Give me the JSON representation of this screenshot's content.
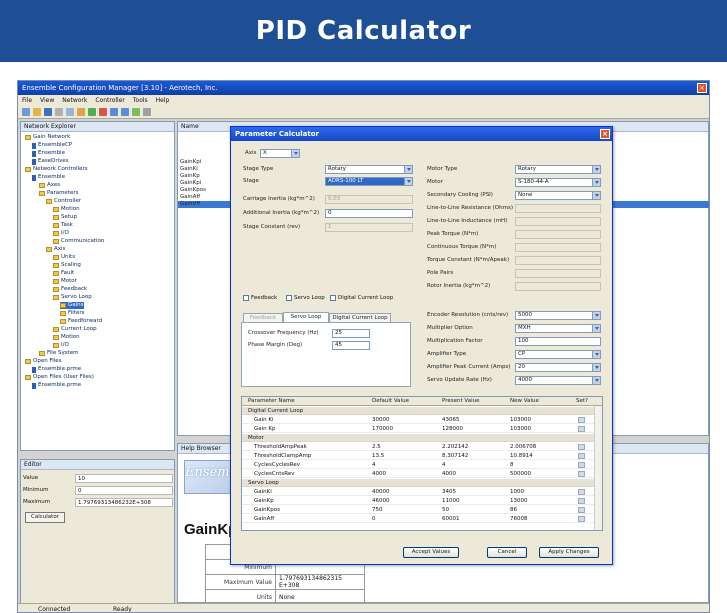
{
  "banner": {
    "title": "PID Calculator"
  },
  "app": {
    "title": "Ensemble Configuration Manager [3.10] - Aerotech, Inc.",
    "menu": [
      "File",
      "View",
      "Network",
      "Controller",
      "Tools",
      "Help"
    ],
    "network_explorer_label": "Network Explorer",
    "name_column": "Name",
    "help_pane_label": "Help Browser",
    "status": {
      "left": "Connected",
      "right": "Ready"
    }
  },
  "tree": [
    {
      "label": "Gain Network",
      "indent": 0,
      "kind": "folder"
    },
    {
      "label": "EnsembleCP",
      "indent": 1,
      "kind": "node"
    },
    {
      "label": "Ensemble",
      "indent": 1,
      "kind": "node"
    },
    {
      "label": "EaseDrives",
      "indent": 1,
      "kind": "node"
    },
    {
      "label": "Network Controllers",
      "indent": 0,
      "kind": "folder"
    },
    {
      "label": "Ensemble",
      "indent": 1,
      "kind": "node"
    },
    {
      "label": "Axes",
      "indent": 2,
      "kind": "folder"
    },
    {
      "label": "Parameters",
      "indent": 2,
      "kind": "folder"
    },
    {
      "label": "Controller",
      "indent": 3,
      "kind": "folder"
    },
    {
      "label": "Motion",
      "indent": 4,
      "kind": "folder"
    },
    {
      "label": "Setup",
      "indent": 4,
      "kind": "folder"
    },
    {
      "label": "Task",
      "indent": 4,
      "kind": "folder"
    },
    {
      "label": "I/O",
      "indent": 4,
      "kind": "folder"
    },
    {
      "label": "Communication",
      "indent": 4,
      "kind": "folder"
    },
    {
      "label": "Axis",
      "indent": 3,
      "kind": "folder"
    },
    {
      "label": "Units",
      "indent": 4,
      "kind": "folder"
    },
    {
      "label": "Scaling",
      "indent": 4,
      "kind": "folder"
    },
    {
      "label": "Fault",
      "indent": 4,
      "kind": "folder"
    },
    {
      "label": "Motor",
      "indent": 4,
      "kind": "folder"
    },
    {
      "label": "Feedback",
      "indent": 4,
      "kind": "folder"
    },
    {
      "label": "Servo Loop",
      "indent": 4,
      "kind": "folder"
    },
    {
      "label": "Gains",
      "indent": 5,
      "kind": "folder",
      "selected": true
    },
    {
      "label": "Filters",
      "indent": 5,
      "kind": "folder"
    },
    {
      "label": "Feedforward",
      "indent": 5,
      "kind": "folder"
    },
    {
      "label": "Current Loop",
      "indent": 4,
      "kind": "folder"
    },
    {
      "label": "Motion",
      "indent": 4,
      "kind": "folder"
    },
    {
      "label": "I/O",
      "indent": 4,
      "kind": "folder"
    },
    {
      "label": "File System",
      "indent": 2,
      "kind": "folder"
    },
    {
      "label": "Open Files",
      "indent": 0,
      "kind": "folder"
    },
    {
      "label": "Ensemble.prme",
      "indent": 1,
      "kind": "node"
    },
    {
      "label": "Open Files (User Files)",
      "indent": 0,
      "kind": "folder"
    },
    {
      "label": "Ensemble.prme",
      "indent": 1,
      "kind": "node"
    }
  ],
  "list_items": [
    "GainKpi",
    "GainKi",
    "GainKp",
    "GainKpi",
    "GainKpos",
    "GainAff",
    "GainVff"
  ],
  "edit_pane": {
    "title": "Editor",
    "rows": [
      {
        "key": "Value",
        "value": "10"
      },
      {
        "key": "Minimum",
        "value": "0"
      },
      {
        "key": "Maximum",
        "value": "1.79769313486232E+308"
      }
    ],
    "calculator_button": "Calculator"
  },
  "help": {
    "logo_text": "Ensemble",
    "heading": "GainKp",
    "rows": [
      {
        "key": "Default",
        "value": ""
      },
      {
        "key": "Minimum",
        "value": ""
      },
      {
        "key": "Maximum Value",
        "value": "1.797693134862315 E+308"
      },
      {
        "key": "Units",
        "value": "None"
      }
    ]
  },
  "dialog": {
    "title": "Parameter Calculator",
    "axis": {
      "label": "Axis",
      "value": "X"
    },
    "left_fields": [
      {
        "label": "Stage Type",
        "value": "Rotary",
        "kind": "select"
      },
      {
        "label": "Stage",
        "value": "ADRS-100 LT",
        "kind": "select",
        "highlight": true
      },
      {
        "label": "Carriage Inertia (kg*m^2)",
        "value": "0.03",
        "kind": "input",
        "disabled": true
      },
      {
        "label": "Additional Inertia (kg*m^2)",
        "value": "0",
        "kind": "input"
      },
      {
        "label": "Stage Constant (rev)",
        "value": "1",
        "kind": "input",
        "disabled": true
      }
    ],
    "right_fields": [
      {
        "label": "Motor Type",
        "value": "Rotary",
        "kind": "select"
      },
      {
        "label": "Motor",
        "value": "S-180-44-A",
        "kind": "select"
      },
      {
        "label": "Secondary Cooling (PSI)",
        "value": "None",
        "kind": "select"
      },
      {
        "label": "Line-to-Line Resistance (Ohms)",
        "value": "",
        "kind": "input",
        "disabled": true
      },
      {
        "label": "Line-to-Line Inductance (mH)",
        "value": "",
        "kind": "input",
        "disabled": true
      },
      {
        "label": "Peak Torque (N*m)",
        "value": "",
        "kind": "input",
        "disabled": true
      },
      {
        "label": "Continuous Torque (N*m)",
        "value": "",
        "kind": "input",
        "disabled": true
      },
      {
        "label": "Torque Constant (N*m/Apeak)",
        "value": "",
        "kind": "input",
        "disabled": true
      },
      {
        "label": "Pole Pairs",
        "value": "",
        "kind": "input",
        "disabled": true
      },
      {
        "label": "Rotor Inertia (kg*m^2)",
        "value": "",
        "kind": "input",
        "disabled": true
      }
    ],
    "checkboxes": [
      "Feedback",
      "Servo Loop",
      "Digital Current Loop"
    ],
    "tabs": [
      "Feedback",
      "Servo Loop",
      "Digital Current Loop"
    ],
    "servo_fields": [
      {
        "label": "Crossover Frequency (Hz)",
        "value": "25"
      },
      {
        "label": "Phase Margin (Deg)",
        "value": "45"
      }
    ],
    "feedback_fields": [
      {
        "label": "Encoder Resolution (cnts/rev)",
        "value": "5000",
        "kind": "select"
      },
      {
        "label": "Multiplier Option",
        "value": "MXH",
        "kind": "select"
      },
      {
        "label": "Multiplication Factor",
        "value": "100",
        "kind": "input"
      },
      {
        "label": "Amplifier Type",
        "value": "CP",
        "kind": "select"
      },
      {
        "label": "Amplifier Peak Current (Amps)",
        "value": "20",
        "kind": "select"
      },
      {
        "label": "Servo Update Rate (Hz)",
        "value": "4000",
        "kind": "select"
      }
    ],
    "grid_columns": [
      "Parameter Name",
      "Default Value",
      "Present Value",
      "New Value",
      "Set?"
    ],
    "grid_groups": [
      {
        "name": "Digital Current Loop",
        "rows": [
          {
            "name": "Gain Ki",
            "default": "30000",
            "present": "43065",
            "new": "103000"
          },
          {
            "name": "Gain Kp",
            "default": "170000",
            "present": "128000",
            "new": "103000"
          }
        ]
      },
      {
        "name": "Motor",
        "rows": [
          {
            "name": "ThresholdAmpPeak",
            "default": "2.5",
            "present": "2.202142",
            "new": "2.006708"
          },
          {
            "name": "ThresholdClampAmp",
            "default": "13.5",
            "present": "8.307142",
            "new": "10.8914"
          },
          {
            "name": "CyclesCyclesRev",
            "default": "4",
            "present": "4",
            "new": "8"
          },
          {
            "name": "CyclesCntsRev",
            "default": "4000",
            "present": "4000",
            "new": "500000"
          }
        ]
      },
      {
        "name": "Servo Loop",
        "rows": [
          {
            "name": "GainKi",
            "default": "40000",
            "present": "3405",
            "new": "1000"
          },
          {
            "name": "GainKp",
            "default": "46000",
            "present": "11000",
            "new": "13000"
          },
          {
            "name": "GainKpos",
            "default": "750",
            "present": "50",
            "new": "86"
          },
          {
            "name": "GainAff",
            "default": "0",
            "present": "60001",
            "new": "76008"
          }
        ]
      }
    ],
    "buttons": {
      "accept": "Accept Values",
      "cancel": "Cancel",
      "apply": "Apply Changes"
    }
  }
}
